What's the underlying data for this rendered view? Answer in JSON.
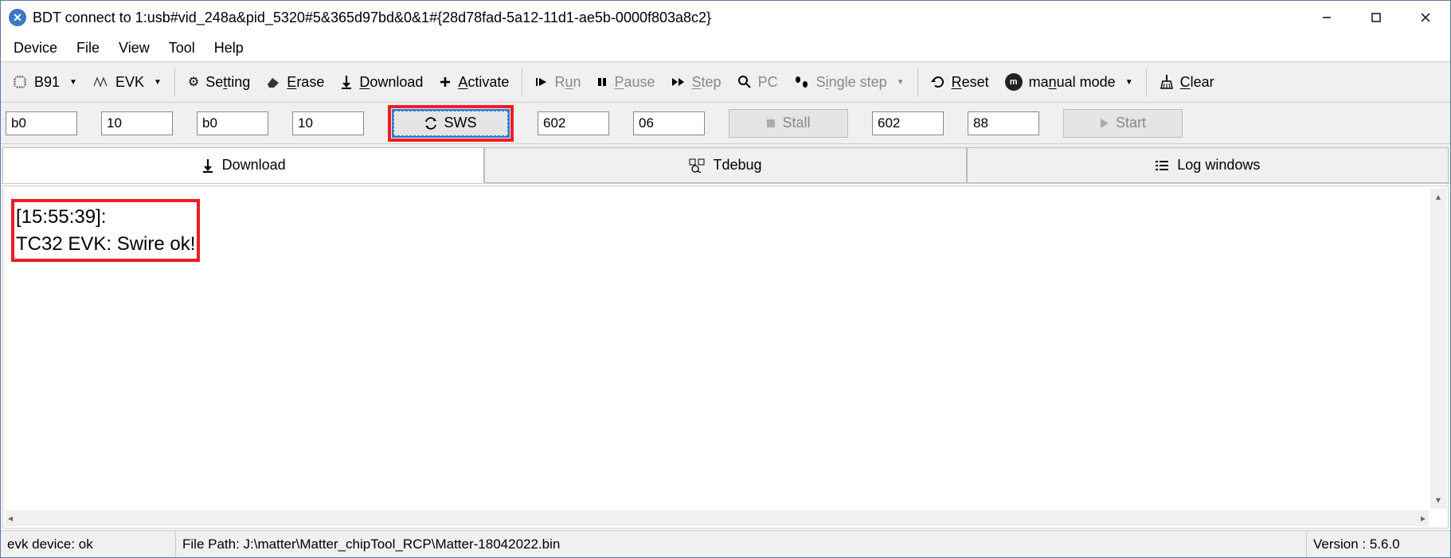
{
  "titlebar": {
    "title": "BDT connect to 1:usb#vid_248a&pid_5320#5&365d97bd&0&1#{28d78fad-5a12-11d1-ae5b-0000f803a8c2}"
  },
  "menubar": {
    "items": [
      "Device",
      "File",
      "View",
      "Tool",
      "Help"
    ]
  },
  "toolbar": {
    "chip": "B91",
    "board": "EVK",
    "setting": "Setting",
    "erase": "Erase",
    "download": "Download",
    "activate": "Activate",
    "run": "Run",
    "pause": "Pause",
    "step": "Step",
    "pc": "PC",
    "singlestep": "Single step",
    "reset": "Reset",
    "manualmode": "manual mode",
    "clear": "Clear"
  },
  "inputs": {
    "f1": "b0",
    "f2": "10",
    "f3": "b0",
    "f4": "10",
    "sws_btn": "SWS",
    "f5": "602",
    "f6": "06",
    "stall_btn": "Stall",
    "f7": "602",
    "f8": "88",
    "start_btn": "Start"
  },
  "tabs": {
    "download": "Download",
    "tdebug": "Tdebug",
    "log": "Log windows"
  },
  "log": {
    "line1": "[15:55:39]:",
    "line2": "TC32 EVK: Swire ok!"
  },
  "status": {
    "device": "evk device: ok",
    "filepath": "File Path:  J:\\matter\\Matter_chipTool_RCP\\Matter-18042022.bin",
    "version": "Version : 5.6.0"
  }
}
